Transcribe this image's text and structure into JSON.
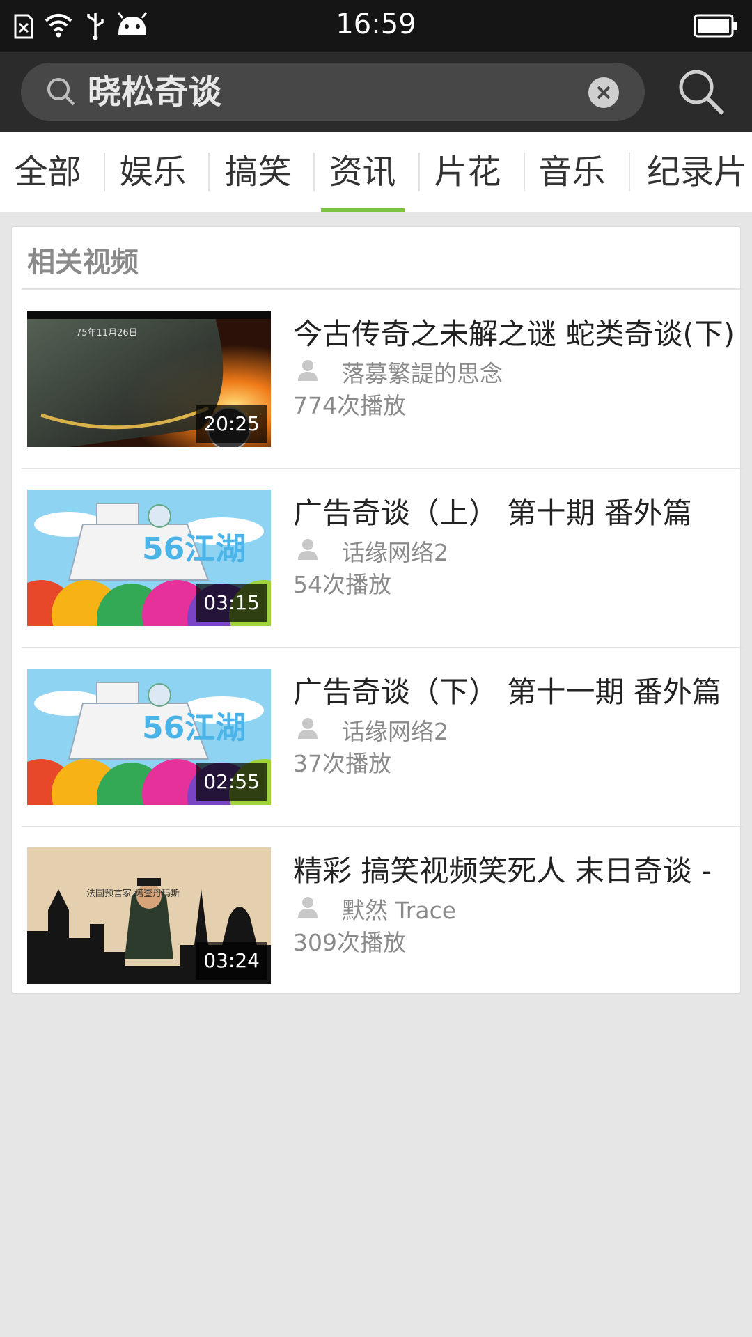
{
  "status_bar": {
    "time": "16:59"
  },
  "search": {
    "query": "晓松奇谈"
  },
  "tabs": [
    {
      "label": "全部",
      "selected": false
    },
    {
      "label": "娱乐",
      "selected": false
    },
    {
      "label": "搞笑",
      "selected": false
    },
    {
      "label": "资讯",
      "selected": true
    },
    {
      "label": "片花",
      "selected": false
    },
    {
      "label": "音乐",
      "selected": false
    },
    {
      "label": "纪录片",
      "selected": false
    }
  ],
  "section": {
    "title": "相关视频"
  },
  "videos": [
    {
      "title": "今古传奇之未解之谜 蛇类奇谈(下)",
      "uploader": "落募繁諟的思念",
      "plays": "774次播放",
      "duration": "20:25",
      "thumb_text": "75年11月26日"
    },
    {
      "title": "广告奇谈（上） 第十期 番外篇",
      "uploader": "话缘网络2",
      "plays": "54次播放",
      "duration": "03:15",
      "thumb_text": "56江湖"
    },
    {
      "title": "广告奇谈（下） 第十一期 番外篇",
      "uploader": "话缘网络2",
      "plays": "37次播放",
      "duration": "02:55",
      "thumb_text": "56江湖"
    },
    {
      "title": "精彩 搞笑视频笑死人 末日奇谈 -",
      "uploader": "默然 Trace",
      "plays": "309次播放",
      "duration": "03:24",
      "thumb_text": "法国预言家 诺查丹玛斯"
    }
  ],
  "colors": {
    "accent": "#7bc142",
    "header": "#2b2b2b",
    "status_bar": "#151515"
  }
}
